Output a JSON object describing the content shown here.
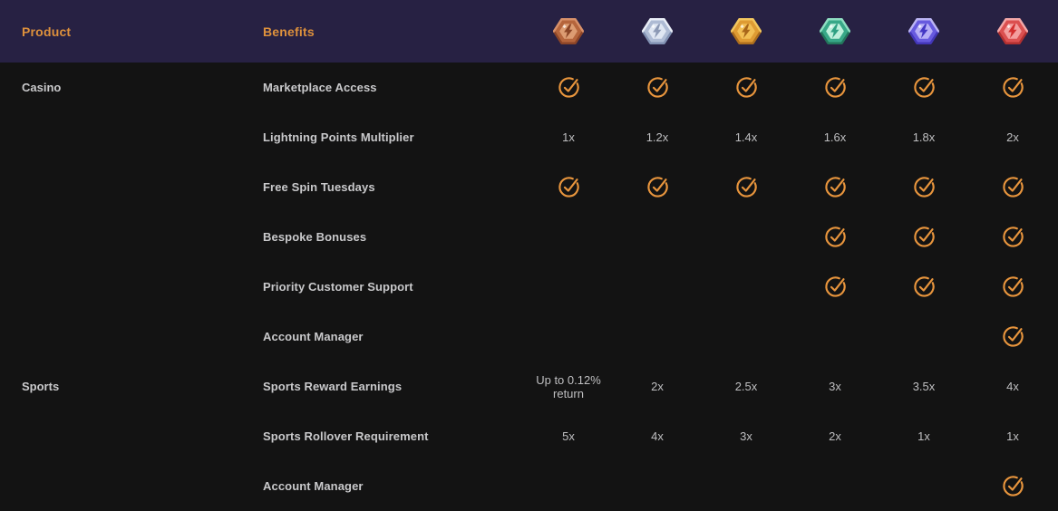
{
  "colors": {
    "body_bg": "#131313",
    "header_bg": "#272143",
    "header_text": "#DE913C",
    "check": "#E8953D"
  },
  "header": {
    "product_label": "Product",
    "benefits_label": "Benefits"
  },
  "tiers": [
    {
      "name": "bronze-badge-icon",
      "base": "#B5653C",
      "light": "#D8916A",
      "dark": "#8C4527",
      "inner": "#DC9C72",
      "bolt": "#8A4526"
    },
    {
      "name": "silver-badge-icon",
      "base": "#AEBBD4",
      "light": "#EAEFF8",
      "dark": "#8292B3",
      "inner": "#DFE6F2",
      "bolt": "#8C99B5"
    },
    {
      "name": "gold-badge-icon",
      "base": "#DE9B33",
      "light": "#F3C75F",
      "dark": "#AD6E1D",
      "inner": "#F2BF55",
      "bolt": "#A8661A"
    },
    {
      "name": "emerald-badge-icon",
      "base": "#38A888",
      "light": "#8FDEC2",
      "dark": "#23775C",
      "inner": "#BFF0DC",
      "bolt": "#2FA183"
    },
    {
      "name": "amethyst-badge-icon",
      "base": "#675ADF",
      "light": "#BCB5F4",
      "dark": "#4336B8",
      "inner": "#B7AFF6",
      "bolt": "#4337C4"
    },
    {
      "name": "ruby-badge-icon",
      "base": "#DB5050",
      "light": "#F3A8A8",
      "dark": "#B23030",
      "inner": "#F39E9E",
      "bolt": "#D32F2F"
    }
  ],
  "rows": [
    {
      "product": "Casino",
      "benefit": "Marketplace Access",
      "values": [
        "check",
        "check",
        "check",
        "check",
        "check",
        "check"
      ]
    },
    {
      "product": "",
      "benefit": "Lightning Points Multiplier",
      "values": [
        "1x",
        "1.2x",
        "1.4x",
        "1.6x",
        "1.8x",
        "2x"
      ]
    },
    {
      "product": "",
      "benefit": "Free Spin Tuesdays",
      "values": [
        "check",
        "check",
        "check",
        "check",
        "check",
        "check"
      ]
    },
    {
      "product": "",
      "benefit": "Bespoke Bonuses",
      "values": [
        "",
        "",
        "",
        "check",
        "check",
        "check"
      ]
    },
    {
      "product": "",
      "benefit": "Priority Customer Support",
      "values": [
        "",
        "",
        "",
        "check",
        "check",
        "check"
      ]
    },
    {
      "product": "",
      "benefit": "Account Manager",
      "values": [
        "",
        "",
        "",
        "",
        "",
        "check"
      ]
    },
    {
      "product": "Sports",
      "benefit": "Sports Reward Earnings",
      "values": [
        "Up to 0.12% return",
        "2x",
        "2.5x",
        "3x",
        "3.5x",
        "4x"
      ]
    },
    {
      "product": "",
      "benefit": "Sports Rollover Requirement",
      "values": [
        "5x",
        "4x",
        "3x",
        "2x",
        "1x",
        "1x"
      ]
    },
    {
      "product": "",
      "benefit": "Account Manager",
      "values": [
        "",
        "",
        "",
        "",
        "",
        "check"
      ]
    }
  ]
}
